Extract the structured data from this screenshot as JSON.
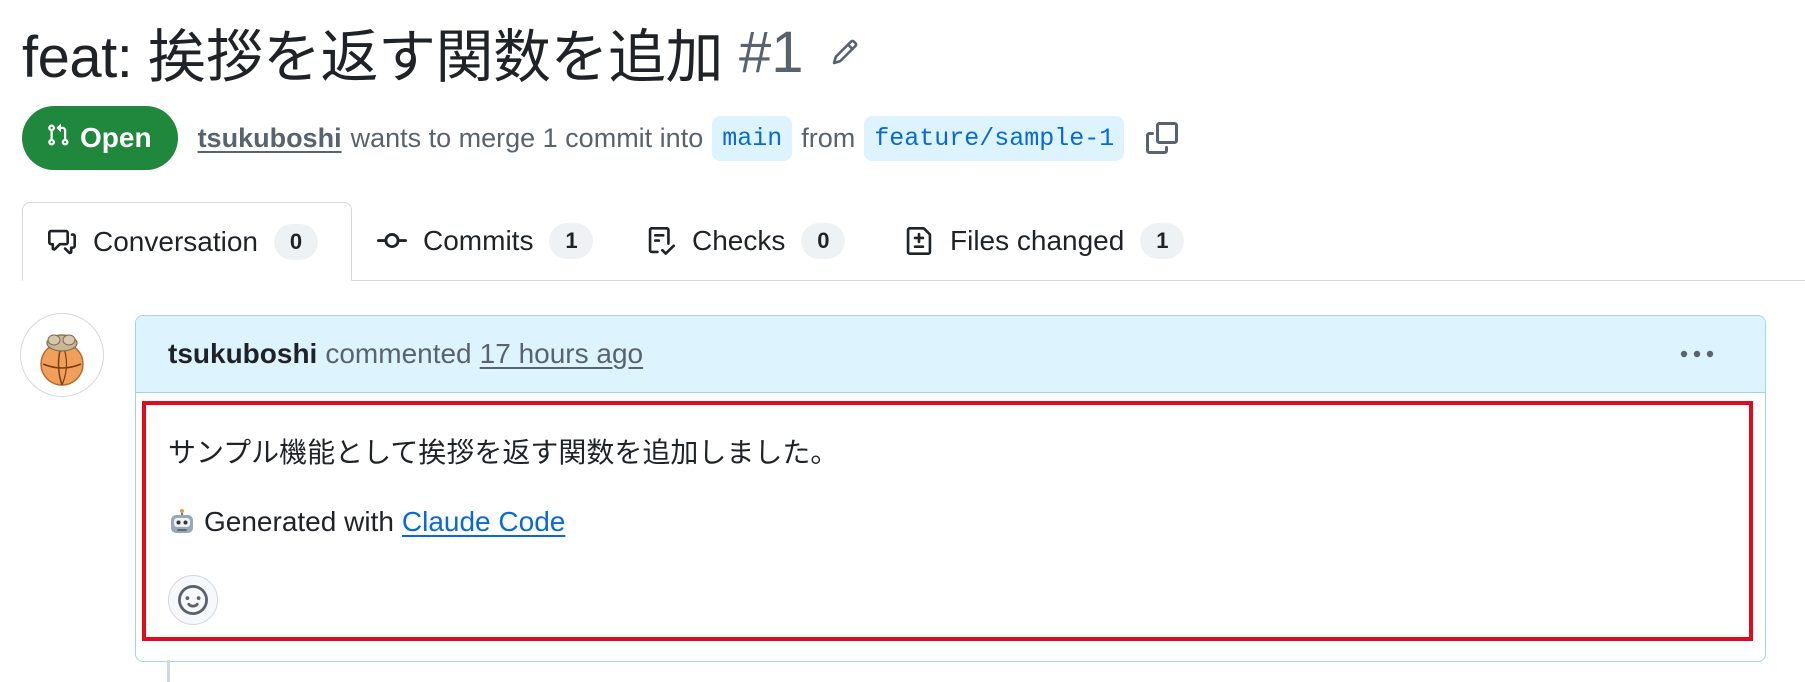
{
  "pr": {
    "title": "feat: 挨拶を返す関数を追加",
    "number": "#1",
    "state": "Open",
    "author": "tsukuboshi",
    "merge_text_1": "wants to merge 1 commit into",
    "base_branch": "main",
    "merge_text_2": "from",
    "head_branch": "feature/sample-1"
  },
  "tabs": [
    {
      "label": "Conversation",
      "count": "0",
      "icon": "comment-discussion-icon",
      "active": true
    },
    {
      "label": "Commits",
      "count": "1",
      "icon": "git-commit-icon",
      "active": false
    },
    {
      "label": "Checks",
      "count": "0",
      "icon": "checklist-icon",
      "active": false
    },
    {
      "label": "Files changed",
      "count": "1",
      "icon": "file-diff-icon",
      "active": false
    }
  ],
  "comment": {
    "author": "tsukuboshi",
    "action": "commented",
    "time": "17 hours ago",
    "body_line1": "サンプル機能として挨拶を返す関数を追加しました。",
    "generated_prefix": "Generated with",
    "link_text": "Claude Code"
  },
  "colors": {
    "open_badge": "#1f883d",
    "link": "#0969da",
    "comment_header_bg": "#ddf4ff",
    "highlight_border": "#e00b1c"
  }
}
